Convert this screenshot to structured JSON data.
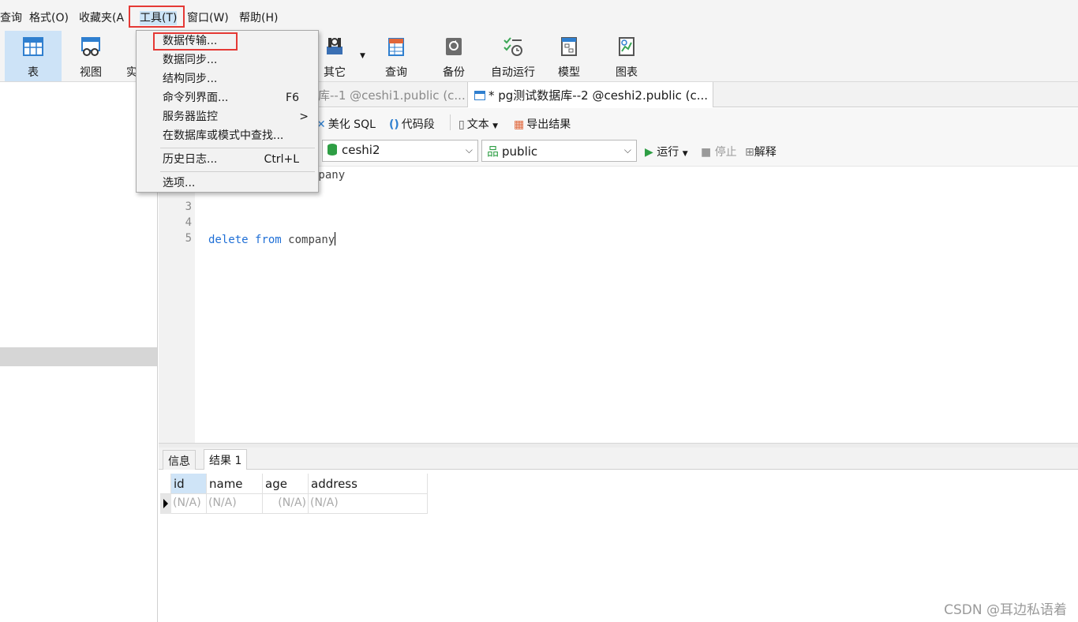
{
  "menubar": {
    "items": [
      "查询",
      "格式(O)",
      "收藏夹(A",
      "工具(T)",
      "窗口(W)",
      "帮助(H)"
    ]
  },
  "toolbar": {
    "buttons": [
      "表",
      "视图",
      "实",
      "其它",
      "查询",
      "备份",
      "自动运行",
      "模型",
      "图表"
    ]
  },
  "tools_menu": {
    "items": [
      {
        "label": "数据传输...",
        "shortcut": ""
      },
      {
        "label": "数据同步...",
        "shortcut": ""
      },
      {
        "label": "结构同步...",
        "shortcut": ""
      },
      {
        "label": "命令列界面...",
        "shortcut": "F6"
      },
      {
        "label": "服务器监控",
        "shortcut": "",
        "submenu": ">"
      },
      {
        "label": "在数据库或模式中查找...",
        "shortcut": ""
      },
      {
        "label": "历史日志...",
        "shortcut": "Ctrl+L"
      },
      {
        "label": "选项...",
        "shortcut": ""
      }
    ]
  },
  "tabs": [
    {
      "label": "库--1 @ceshi1.public (c...",
      "active": false
    },
    {
      "label": "* pg测试数据库--2 @ceshi2.public (c...",
      "active": true
    }
  ],
  "query_toolbar": {
    "beautify": "美化 SQL",
    "snippet": "代码段",
    "text": "文本",
    "export": "导出结果"
  },
  "connection": {
    "database": "ceshi2",
    "schema": "public",
    "run": "运行",
    "stop": "停止",
    "explain": "解释"
  },
  "editor": {
    "lines": [
      {
        "num": "",
        "text": "mpany"
      },
      {
        "num": "",
        "text": ""
      },
      {
        "num": "3",
        "text": ""
      },
      {
        "num": "4",
        "text": ""
      },
      {
        "num": "5",
        "kw1": "delete",
        "kw2": "from",
        "rest": "company"
      }
    ]
  },
  "results": {
    "tabs": [
      "信息",
      "结果 1"
    ],
    "columns": [
      "id",
      "name",
      "age",
      "address"
    ],
    "row": [
      "(N/A)",
      "(N/A)",
      "(N/A)",
      "(N/A)"
    ]
  },
  "watermark": "CSDN @耳边私语着",
  "colors": {
    "accent": "#e53935",
    "selection": "#cce4f7",
    "keyword": "#1f6fd6"
  }
}
